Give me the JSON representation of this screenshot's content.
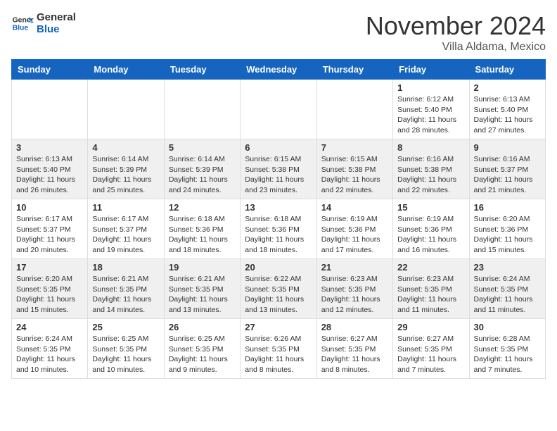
{
  "header": {
    "logo_general": "General",
    "logo_blue": "Blue",
    "month_title": "November 2024",
    "subtitle": "Villa Aldama, Mexico"
  },
  "days_of_week": [
    "Sunday",
    "Monday",
    "Tuesday",
    "Wednesday",
    "Thursday",
    "Friday",
    "Saturday"
  ],
  "weeks": [
    {
      "days": [
        {
          "date": "",
          "info": ""
        },
        {
          "date": "",
          "info": ""
        },
        {
          "date": "",
          "info": ""
        },
        {
          "date": "",
          "info": ""
        },
        {
          "date": "",
          "info": ""
        },
        {
          "date": "1",
          "info": "Sunrise: 6:12 AM\nSunset: 5:40 PM\nDaylight: 11 hours\nand 28 minutes."
        },
        {
          "date": "2",
          "info": "Sunrise: 6:13 AM\nSunset: 5:40 PM\nDaylight: 11 hours\nand 27 minutes."
        }
      ]
    },
    {
      "days": [
        {
          "date": "3",
          "info": "Sunrise: 6:13 AM\nSunset: 5:40 PM\nDaylight: 11 hours\nand 26 minutes."
        },
        {
          "date": "4",
          "info": "Sunrise: 6:14 AM\nSunset: 5:39 PM\nDaylight: 11 hours\nand 25 minutes."
        },
        {
          "date": "5",
          "info": "Sunrise: 6:14 AM\nSunset: 5:39 PM\nDaylight: 11 hours\nand 24 minutes."
        },
        {
          "date": "6",
          "info": "Sunrise: 6:15 AM\nSunset: 5:38 PM\nDaylight: 11 hours\nand 23 minutes."
        },
        {
          "date": "7",
          "info": "Sunrise: 6:15 AM\nSunset: 5:38 PM\nDaylight: 11 hours\nand 22 minutes."
        },
        {
          "date": "8",
          "info": "Sunrise: 6:16 AM\nSunset: 5:38 PM\nDaylight: 11 hours\nand 22 minutes."
        },
        {
          "date": "9",
          "info": "Sunrise: 6:16 AM\nSunset: 5:37 PM\nDaylight: 11 hours\nand 21 minutes."
        }
      ]
    },
    {
      "days": [
        {
          "date": "10",
          "info": "Sunrise: 6:17 AM\nSunset: 5:37 PM\nDaylight: 11 hours\nand 20 minutes."
        },
        {
          "date": "11",
          "info": "Sunrise: 6:17 AM\nSunset: 5:37 PM\nDaylight: 11 hours\nand 19 minutes."
        },
        {
          "date": "12",
          "info": "Sunrise: 6:18 AM\nSunset: 5:36 PM\nDaylight: 11 hours\nand 18 minutes."
        },
        {
          "date": "13",
          "info": "Sunrise: 6:18 AM\nSunset: 5:36 PM\nDaylight: 11 hours\nand 18 minutes."
        },
        {
          "date": "14",
          "info": "Sunrise: 6:19 AM\nSunset: 5:36 PM\nDaylight: 11 hours\nand 17 minutes."
        },
        {
          "date": "15",
          "info": "Sunrise: 6:19 AM\nSunset: 5:36 PM\nDaylight: 11 hours\nand 16 minutes."
        },
        {
          "date": "16",
          "info": "Sunrise: 6:20 AM\nSunset: 5:36 PM\nDaylight: 11 hours\nand 15 minutes."
        }
      ]
    },
    {
      "days": [
        {
          "date": "17",
          "info": "Sunrise: 6:20 AM\nSunset: 5:35 PM\nDaylight: 11 hours\nand 15 minutes."
        },
        {
          "date": "18",
          "info": "Sunrise: 6:21 AM\nSunset: 5:35 PM\nDaylight: 11 hours\nand 14 minutes."
        },
        {
          "date": "19",
          "info": "Sunrise: 6:21 AM\nSunset: 5:35 PM\nDaylight: 11 hours\nand 13 minutes."
        },
        {
          "date": "20",
          "info": "Sunrise: 6:22 AM\nSunset: 5:35 PM\nDaylight: 11 hours\nand 13 minutes."
        },
        {
          "date": "21",
          "info": "Sunrise: 6:23 AM\nSunset: 5:35 PM\nDaylight: 11 hours\nand 12 minutes."
        },
        {
          "date": "22",
          "info": "Sunrise: 6:23 AM\nSunset: 5:35 PM\nDaylight: 11 hours\nand 11 minutes."
        },
        {
          "date": "23",
          "info": "Sunrise: 6:24 AM\nSunset: 5:35 PM\nDaylight: 11 hours\nand 11 minutes."
        }
      ]
    },
    {
      "days": [
        {
          "date": "24",
          "info": "Sunrise: 6:24 AM\nSunset: 5:35 PM\nDaylight: 11 hours\nand 10 minutes."
        },
        {
          "date": "25",
          "info": "Sunrise: 6:25 AM\nSunset: 5:35 PM\nDaylight: 11 hours\nand 10 minutes."
        },
        {
          "date": "26",
          "info": "Sunrise: 6:25 AM\nSunset: 5:35 PM\nDaylight: 11 hours\nand 9 minutes."
        },
        {
          "date": "27",
          "info": "Sunrise: 6:26 AM\nSunset: 5:35 PM\nDaylight: 11 hours\nand 8 minutes."
        },
        {
          "date": "28",
          "info": "Sunrise: 6:27 AM\nSunset: 5:35 PM\nDaylight: 11 hours\nand 8 minutes."
        },
        {
          "date": "29",
          "info": "Sunrise: 6:27 AM\nSunset: 5:35 PM\nDaylight: 11 hours\nand 7 minutes."
        },
        {
          "date": "30",
          "info": "Sunrise: 6:28 AM\nSunset: 5:35 PM\nDaylight: 11 hours\nand 7 minutes."
        }
      ]
    }
  ]
}
